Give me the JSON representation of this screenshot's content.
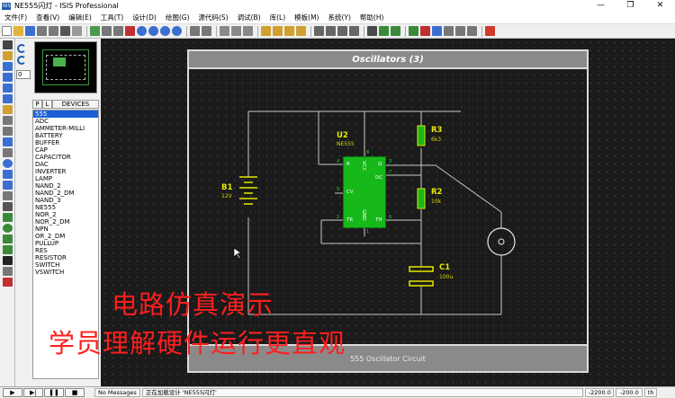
{
  "window": {
    "title": "NE555闪灯 - ISIS Professional",
    "logo_text": "ISIS",
    "minimize": "—",
    "maximize": "❐",
    "close": "✕"
  },
  "menu": [
    "文件(F)",
    "查看(V)",
    "编辑(E)",
    "工具(T)",
    "设计(D)",
    "绘图(G)",
    "源代码(S)",
    "调试(B)",
    "库(L)",
    "模板(M)",
    "系统(Y)",
    "帮助(H)"
  ],
  "panel": {
    "rotation_value": "0",
    "tabs": [
      "P",
      "L"
    ],
    "header": "DEVICES",
    "devices": [
      "555",
      "ADC",
      "AMMETER-MILLI",
      "BATTERY",
      "BUFFER",
      "CAP",
      "CAPACITOR",
      "DAC",
      "INVERTER",
      "LAMP",
      "NAND_2",
      "NAND_2_DM",
      "NAND_3",
      "NE555",
      "NOR_2",
      "NOR_2_DM",
      "NPN",
      "OR_2_DM",
      "PULLUP",
      "RES",
      "RESISTOR",
      "SWITCH",
      "VSWITCH"
    ],
    "selected_device": "555"
  },
  "schematic": {
    "sheet_title": "Oscillators (3)",
    "sheet_footer": "555 Oscillator Circuit",
    "u2": {
      "ref": "U2",
      "part": "NE555",
      "pins": {
        "R": "R",
        "VCC": "VCC",
        "Q": "Q",
        "CV": "CV",
        "DC": "DC",
        "TR": "TR",
        "GND": "GND",
        "TH": "TH"
      },
      "pin_numbers": [
        "4",
        "8",
        "3",
        "5",
        "7",
        "2",
        "1",
        "6"
      ]
    },
    "r3": {
      "ref": "R3",
      "value": "6k3"
    },
    "r2": {
      "ref": "R2",
      "value": "10k"
    },
    "c1": {
      "ref": "C1",
      "value": "100u"
    },
    "b1": {
      "ref": "B1",
      "value": "12V"
    }
  },
  "overlay": {
    "line1": "电路仿真演示",
    "line2": "学员理解硬件运行更直观",
    "color": "#ff1e1e"
  },
  "status": {
    "sim_buttons": [
      "▶",
      "▶|",
      "❚❚",
      "■"
    ],
    "messages": "No Messages",
    "text": "正在加载设计 'NE555闪灯'",
    "coord_x": "-2200.0",
    "coord_y": "-200.0",
    "unit": "th"
  },
  "colors": {
    "wire": "#c8c8c8",
    "component": "#e8e800",
    "chip": "#16b81a",
    "canvas": "#1b1b1b"
  }
}
